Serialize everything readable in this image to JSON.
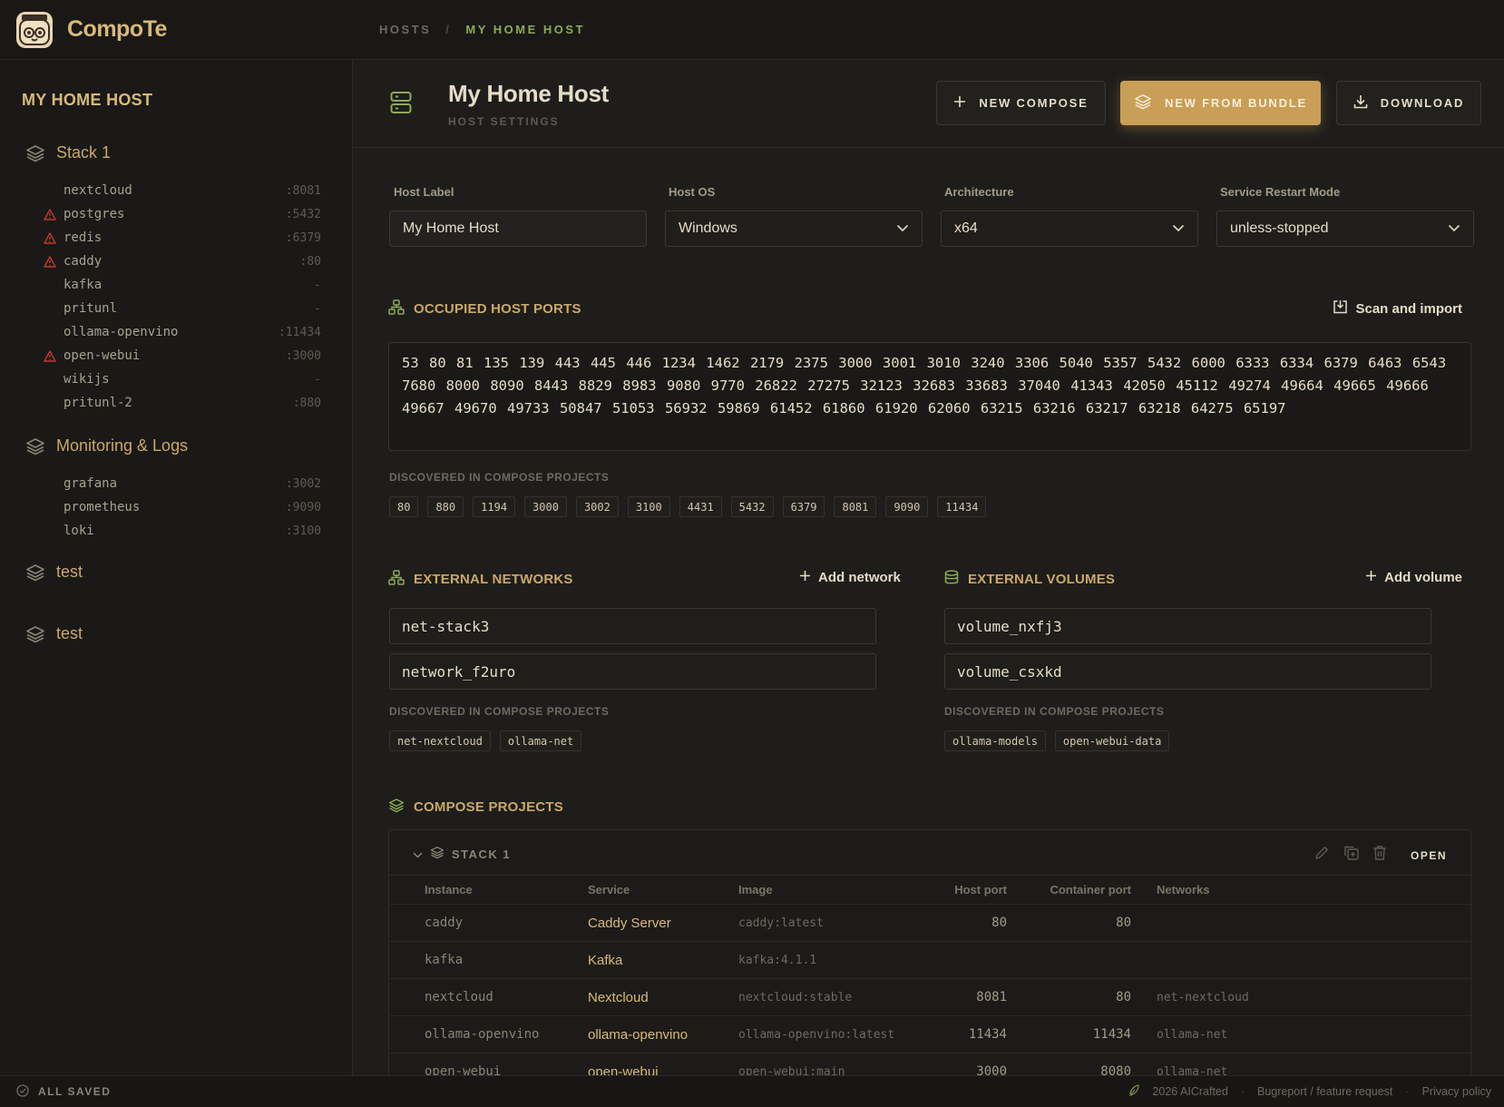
{
  "app": {
    "name": "CompoTe"
  },
  "breadcrumb": {
    "root": "HOSTS",
    "separator": "/",
    "current": "MY HOME HOST"
  },
  "sidebar": {
    "title": "MY HOME HOST",
    "groups": [
      {
        "name": "Stack 1",
        "services": [
          {
            "name": "nextcloud",
            "port": ":8081",
            "warning": false
          },
          {
            "name": "postgres",
            "port": ":5432",
            "warning": true
          },
          {
            "name": "redis",
            "port": ":6379",
            "warning": true
          },
          {
            "name": "caddy",
            "port": ":80",
            "warning": true
          },
          {
            "name": "kafka",
            "port": "-",
            "warning": false
          },
          {
            "name": "pritunl",
            "port": "-",
            "warning": false
          },
          {
            "name": "ollama-openvino",
            "port": ":11434",
            "warning": false
          },
          {
            "name": "open-webui",
            "port": ":3000",
            "warning": true
          },
          {
            "name": "wikijs",
            "port": "-",
            "warning": false
          },
          {
            "name": "pritunl-2",
            "port": ":880",
            "warning": false
          }
        ]
      },
      {
        "name": "Monitoring & Logs",
        "services": [
          {
            "name": "grafana",
            "port": ":3002",
            "warning": false
          },
          {
            "name": "prometheus",
            "port": ":9090",
            "warning": false
          },
          {
            "name": "loki",
            "port": ":3100",
            "warning": false
          }
        ]
      },
      {
        "name": "test",
        "services": []
      },
      {
        "name": "test",
        "services": []
      }
    ]
  },
  "host": {
    "title": "My Home Host",
    "subtitle": "HOST SETTINGS",
    "actions": {
      "new_compose": "NEW COMPOSE",
      "new_from_bundle": "NEW FROM BUNDLE",
      "download": "DOWNLOAD"
    },
    "fields": {
      "label": {
        "label": "Host Label",
        "value": "My Home Host"
      },
      "os": {
        "label": "Host OS",
        "value": "Windows"
      },
      "arch": {
        "label": "Architecture",
        "value": "x64"
      },
      "restart": {
        "label": "Service Restart Mode",
        "value": "unless-stopped"
      }
    }
  },
  "ports": {
    "title": "OCCUPIED HOST PORTS",
    "scan_label": "Scan and import",
    "text": "53 80 81 135 139 443 445 446 1234 1462 2179 2375 3000 3001 3010 3240 3306 5040 5357 5432 6000 6333 6334 6379 6463 6543 7680 8000 8090 8443 8829 8983 9080 9770 26822 27275 32123 32683 33683 37040 41343 42050 45112 49274 49664 49665 49666 49667 49670 49733 50847 51053 56932 59869 61452 61860 61920 62060 63215 63216 63217 63218 64275 65197",
    "discovered_label": "DISCOVERED IN COMPOSE PROJECTS",
    "discovered": [
      "80",
      "880",
      "1194",
      "3000",
      "3002",
      "3100",
      "4431",
      "5432",
      "6379",
      "8081",
      "9090",
      "11434"
    ]
  },
  "networks": {
    "title": "EXTERNAL NETWORKS",
    "add_label": "Add network",
    "items": [
      "net-stack3",
      "network_f2uro"
    ],
    "discovered_label": "DISCOVERED IN COMPOSE PROJECTS",
    "discovered": [
      "net-nextcloud",
      "ollama-net"
    ]
  },
  "volumes": {
    "title": "EXTERNAL VOLUMES",
    "add_label": "Add volume",
    "items": [
      "volume_nxfj3",
      "volume_csxkd"
    ],
    "discovered_label": "DISCOVERED IN COMPOSE PROJECTS",
    "discovered": [
      "ollama-models",
      "open-webui-data"
    ]
  },
  "compose": {
    "title": "COMPOSE PROJECTS",
    "project": {
      "name": "STACK 1",
      "open_label": "OPEN",
      "columns": [
        "Instance",
        "Service",
        "Image",
        "Host port",
        "Container port",
        "Networks"
      ],
      "rows": [
        {
          "instance": "caddy",
          "service": "Caddy Server",
          "image": "caddy:latest",
          "host_port": "80",
          "container_port": "80",
          "networks": ""
        },
        {
          "instance": "kafka",
          "service": "Kafka",
          "image": "kafka:4.1.1",
          "host_port": "",
          "container_port": "",
          "networks": ""
        },
        {
          "instance": "nextcloud",
          "service": "Nextcloud",
          "image": "nextcloud:stable",
          "host_port": "8081",
          "container_port": "80",
          "networks": "net-nextcloud"
        },
        {
          "instance": "ollama-openvino",
          "service": "ollama-openvino",
          "image": "ollama-openvino:latest",
          "host_port": "11434",
          "container_port": "11434",
          "networks": "ollama-net"
        },
        {
          "instance": "open-webui",
          "service": "open-webui",
          "image": "open-webui:main",
          "host_port": "3000",
          "container_port": "8080",
          "networks": "ollama-net"
        }
      ]
    }
  },
  "status": {
    "saved": "ALL SAVED",
    "copyright": "2026 AICrafted",
    "bugreport": "Bugreport / feature request",
    "privacy": "Privacy policy"
  },
  "colors": {
    "accent": "#c99e56",
    "accent_text": "#cba865",
    "green": "#8fa956",
    "warning": "#c0392b",
    "background": "#1e1d1b"
  }
}
